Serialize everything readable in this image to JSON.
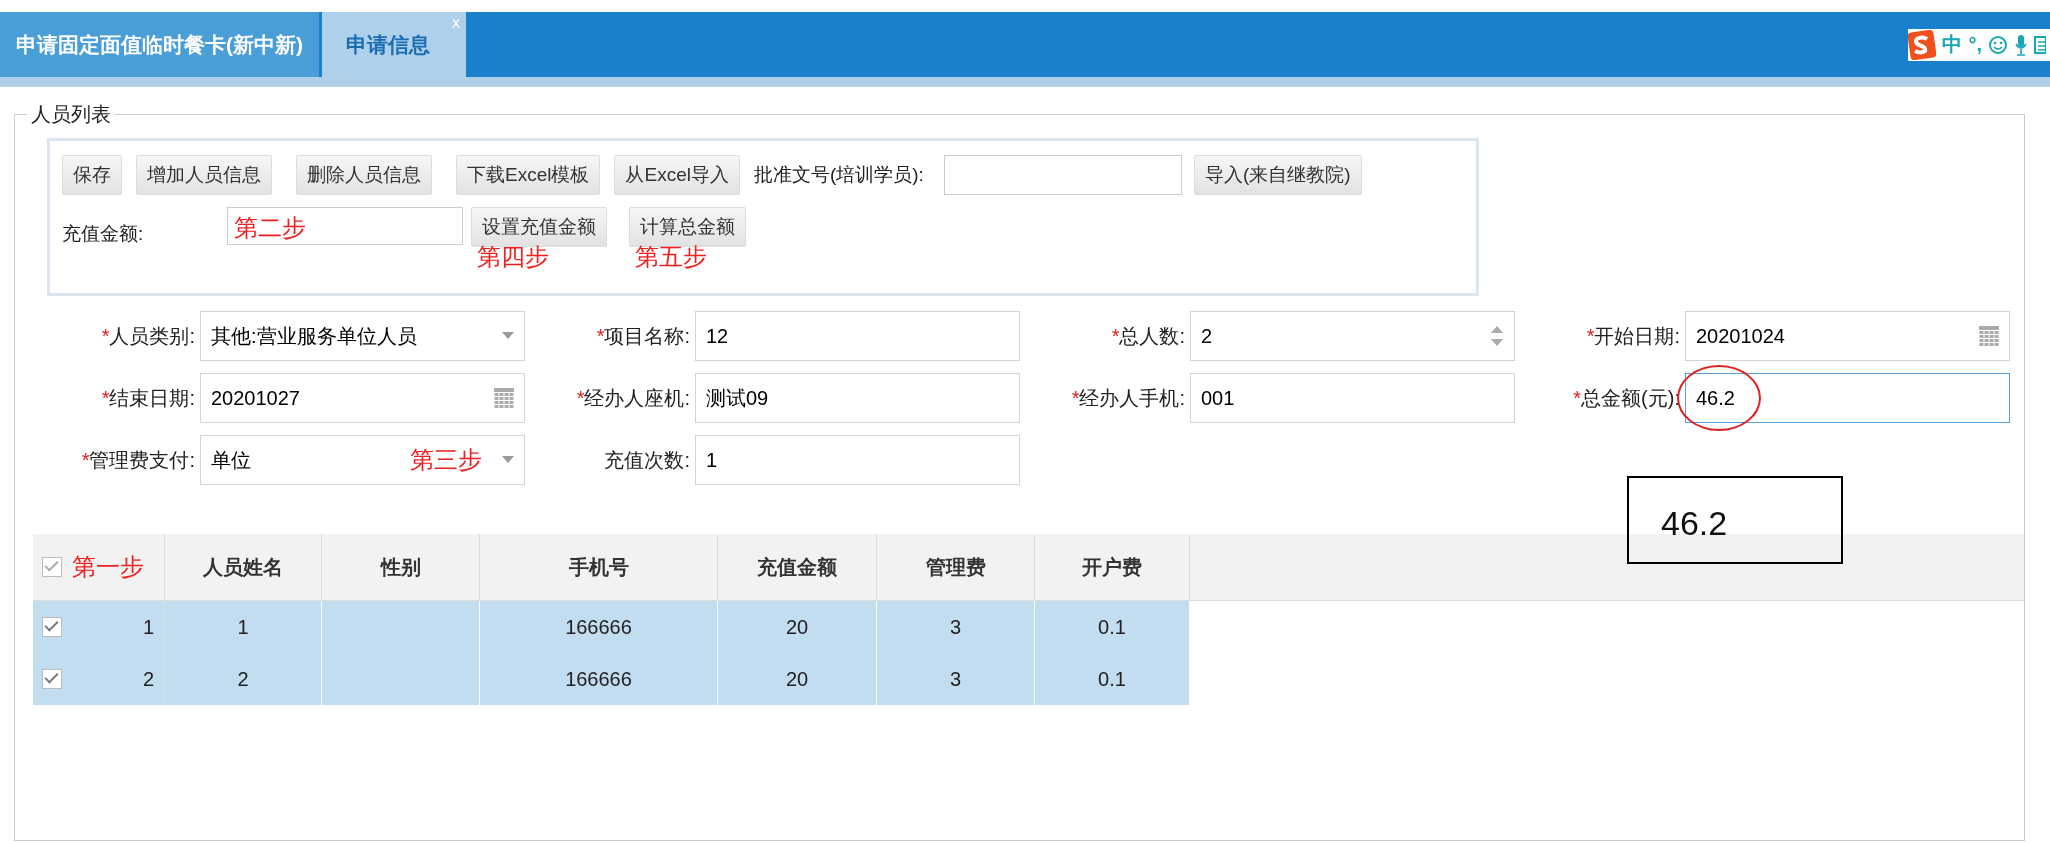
{
  "tabs": [
    {
      "label": "申请固定面值临时餐卡(新中新)",
      "selected": false
    },
    {
      "label": "申请信息",
      "selected": true,
      "close_glyph": "x"
    }
  ],
  "ime_bar": {
    "glyphs": [
      "中",
      "°,"
    ]
  },
  "panel": {
    "legend": "人员列表",
    "toolbar": {
      "buttons": [
        {
          "label": "保存"
        },
        {
          "label": "增加人员信息"
        },
        {
          "label": "删除人员信息"
        },
        {
          "label": "下载Excel模板"
        },
        {
          "label": "从Excel导入"
        }
      ],
      "approval_label": "批准文号(培训学员):",
      "import_button": "导入(来自继教院)",
      "amount_label": "充值金额:",
      "amount_note": "第二步",
      "amount_buttons": [
        {
          "label": "设置充值金额",
          "note": "第四步"
        },
        {
          "label": "计算总金额",
          "note": "第五步"
        }
      ]
    },
    "form": [
      {
        "label": "人员类别:",
        "mark": "*",
        "kind": "select",
        "value": "其他:营业服务单位人员",
        "focused": false
      },
      {
        "label": "项目名称:",
        "mark": "*",
        "kind": "text",
        "value": "12",
        "focused": false
      },
      {
        "label": "总人数:",
        "mark": "*",
        "kind": "spinner",
        "value": "2",
        "focused": false
      },
      {
        "label": "开始日期:",
        "mark": "*",
        "kind": "date",
        "value": "20201024",
        "focused": false
      },
      {
        "label": "结束日期:",
        "mark": "*",
        "kind": "date",
        "value": "20201027",
        "focused": false
      },
      {
        "label": "经办人座机:",
        "mark": "*",
        "kind": "text",
        "value": "测试09",
        "focused": false
      },
      {
        "label": "经办人手机:",
        "mark": "*",
        "kind": "text",
        "value": "001",
        "focused": false
      },
      {
        "label": "总金额(元):",
        "mark": "*",
        "kind": "text",
        "value": "46.2",
        "focused": true,
        "circled": true
      },
      {
        "label": "管理费支付:",
        "mark": "*",
        "kind": "select",
        "value": "单位",
        "note": "第三步",
        "focused": false
      },
      {
        "label": "充值次数:",
        "kind": "text",
        "value": "1",
        "focused": false
      }
    ],
    "callout": "46.2",
    "table": {
      "all_checked": true,
      "header_note": "第一步",
      "columns": [
        "人员姓名",
        "性别",
        "手机号",
        "充值金额",
        "管理费",
        "开户费"
      ],
      "rows": [
        {
          "index": "1",
          "checked": true,
          "cells": [
            "1",
            "",
            "166666",
            "20",
            "3",
            "0.1"
          ]
        },
        {
          "index": "2",
          "checked": true,
          "cells": [
            "2",
            "",
            "166666",
            "20",
            "3",
            "0.1"
          ]
        }
      ]
    }
  }
}
